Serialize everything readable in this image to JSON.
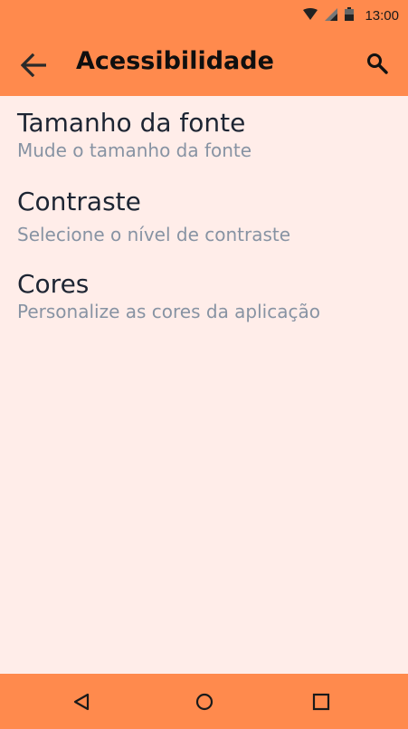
{
  "status_bar": {
    "time": "13:00",
    "icons": [
      "wifi-icon",
      "signal-icon",
      "battery-icon"
    ]
  },
  "app_bar": {
    "title": "Acessibilidade",
    "back_icon": "arrow-back-icon",
    "search_icon": "search-icon"
  },
  "settings": [
    {
      "title": "Tamanho da fonte",
      "subtitle": "Mude o tamanho da fonte"
    },
    {
      "title": "Contraste",
      "subtitle": "Selecione o nível de contraste"
    },
    {
      "title": "Cores",
      "subtitle": "Personalize as cores da aplicação"
    }
  ],
  "nav_bar": {
    "icons": [
      "back-triangle-icon",
      "home-circle-icon",
      "recents-square-icon"
    ]
  },
  "colors": {
    "primary": "#ff8a4d",
    "background": "#ffede9",
    "title_text": "#1d2533",
    "subtitle_text": "#8793a3"
  }
}
